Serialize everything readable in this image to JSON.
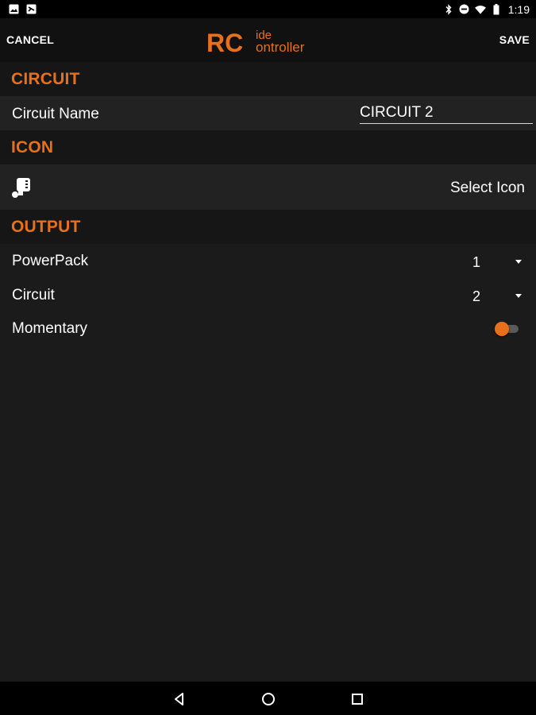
{
  "status_bar": {
    "time": "1:19",
    "left_icons": [
      "image-notification-icon",
      "cast-notification-icon"
    ],
    "right_icons": [
      "bluetooth-icon",
      "do-not-disturb-icon",
      "wifi-icon",
      "battery-icon"
    ]
  },
  "action_bar": {
    "cancel_label": "CANCEL",
    "save_label": "SAVE",
    "logo": {
      "big": "RC",
      "top_small": "ide",
      "bottom_small": "ontroller"
    }
  },
  "sections": {
    "circuit": {
      "title": "CIRCUIT",
      "name_label": "Circuit Name",
      "name_value": "CIRCUIT 2"
    },
    "icon": {
      "title": "ICON",
      "select_label": "Select Icon",
      "current_icon": "power-plug-icon"
    },
    "output": {
      "title": "OUTPUT",
      "powerpack_label": "PowerPack",
      "powerpack_value": "1",
      "circuit_label": "Circuit",
      "circuit_value": "2",
      "momentary_label": "Momentary",
      "momentary_on": true
    }
  },
  "nav_bar": {
    "buttons": [
      "back-icon",
      "home-icon",
      "recents-icon"
    ]
  },
  "colors": {
    "accent": "#e8701a",
    "background": "#1b1b1b",
    "row_band": "#222222",
    "header_band": "#161616"
  }
}
